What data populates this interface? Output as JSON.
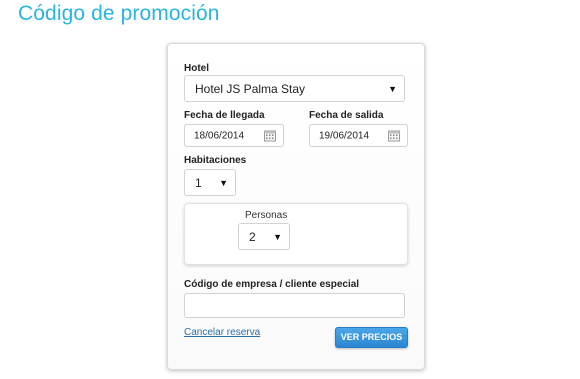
{
  "page": {
    "title": "Código de promoción"
  },
  "form": {
    "hotel_label": "Hotel",
    "hotel_value": "Hotel JS Palma Stay",
    "checkin_label": "Fecha de llegada",
    "checkin_value": "18/06/2014",
    "checkout_label": "Fecha de salida",
    "checkout_value": "19/06/2014",
    "rooms_label": "Habitaciones",
    "rooms_value": "1",
    "persons_label": "Personas",
    "persons_value": "2",
    "company_code_label": "Código de empresa / cliente especial",
    "company_code_value": "",
    "cancel_link": "Cancelar reserva",
    "submit_label": "VER PRECIOS"
  },
  "colors": {
    "title": "#2ab4e0",
    "button": "#3a96dd",
    "link": "#2a6fa8"
  },
  "icons": {
    "dropdown": "chevron-down-icon",
    "calendar": "calendar-icon"
  }
}
